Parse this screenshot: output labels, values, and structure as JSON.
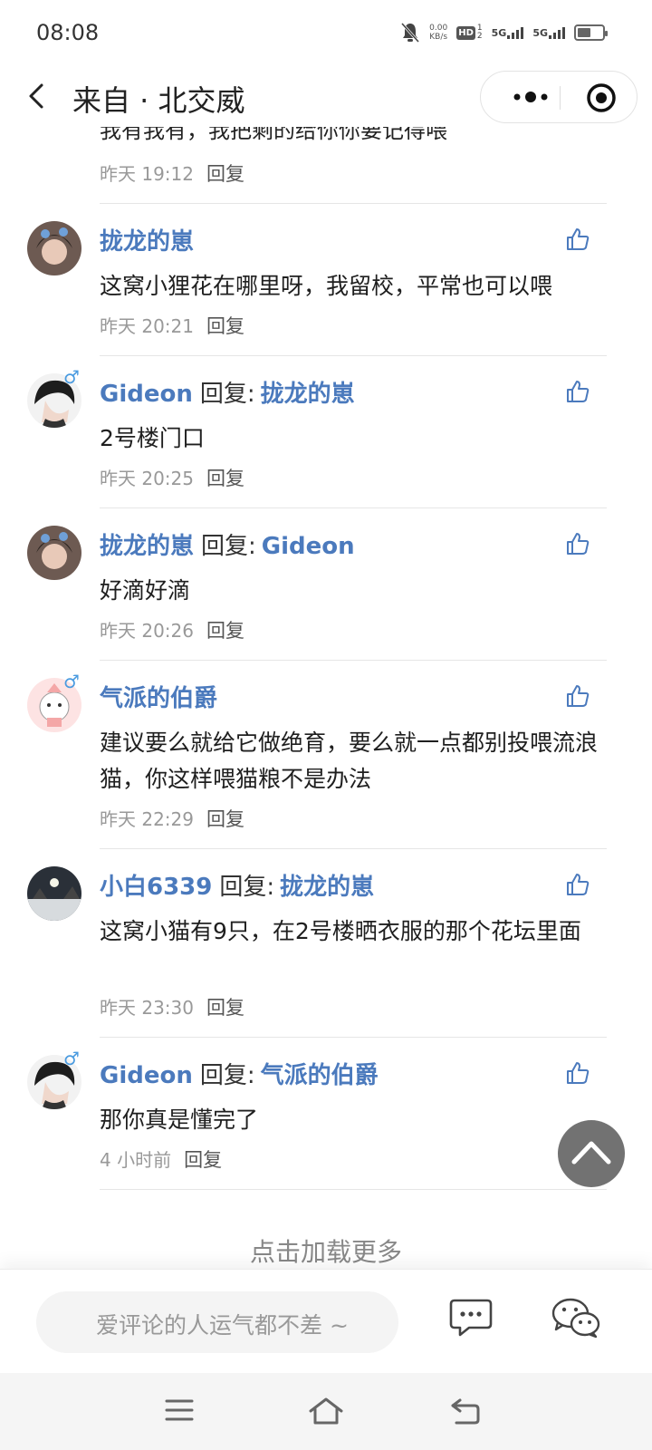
{
  "status": {
    "time": "08:08",
    "net_speed": "0.00",
    "net_unit": "KB/s",
    "hd": "HD",
    "sim1": "1",
    "sim2": "2",
    "sig1": "5G",
    "sig2": "5G"
  },
  "nav": {
    "title": "来自 · 北交威"
  },
  "partial": {
    "text": "我有我有，我把剩的给你你要记得喂",
    "time": "昨天 19:12",
    "reply": "回复"
  },
  "comments": [
    {
      "name": "拢龙的崽",
      "reply_word": "",
      "target": "",
      "text": "这窝小狸花在哪里呀，我留校，平常也可以喂",
      "time": "昨天 20:21",
      "reply": "回复"
    },
    {
      "name": "Gideon",
      "reply_word": "回复:",
      "target": "拢龙的崽",
      "gender": "♂",
      "text": "2号楼门口",
      "time": "昨天 20:25",
      "reply": "回复"
    },
    {
      "name": "拢龙的崽",
      "reply_word": "回复:",
      "target": "Gideon",
      "text": "好滴好滴",
      "time": "昨天 20:26",
      "reply": "回复"
    },
    {
      "name": "气派的伯爵",
      "reply_word": "",
      "target": "",
      "gender": "♂",
      "text": "建议要么就给它做绝育，要么就一点都别投喂流浪猫，你这样喂猫粮不是办法",
      "time": "昨天 22:29",
      "reply": "回复"
    },
    {
      "name": "小白6339",
      "reply_word": "回复:",
      "target": "拢龙的崽",
      "text": "这窝小猫有9只，在2号楼晒衣服的那个花坛里面",
      "time": "昨天 23:30",
      "reply": "回复"
    },
    {
      "name": "Gideon",
      "reply_word": "回复:",
      "target": "气派的伯爵",
      "gender": "♂",
      "text": "那你真是懂完了",
      "time": "4 小时前",
      "reply": "回复"
    }
  ],
  "load_more": "点击加载更多",
  "input": {
    "placeholder": "爱评论的人运气都不差 ~"
  }
}
